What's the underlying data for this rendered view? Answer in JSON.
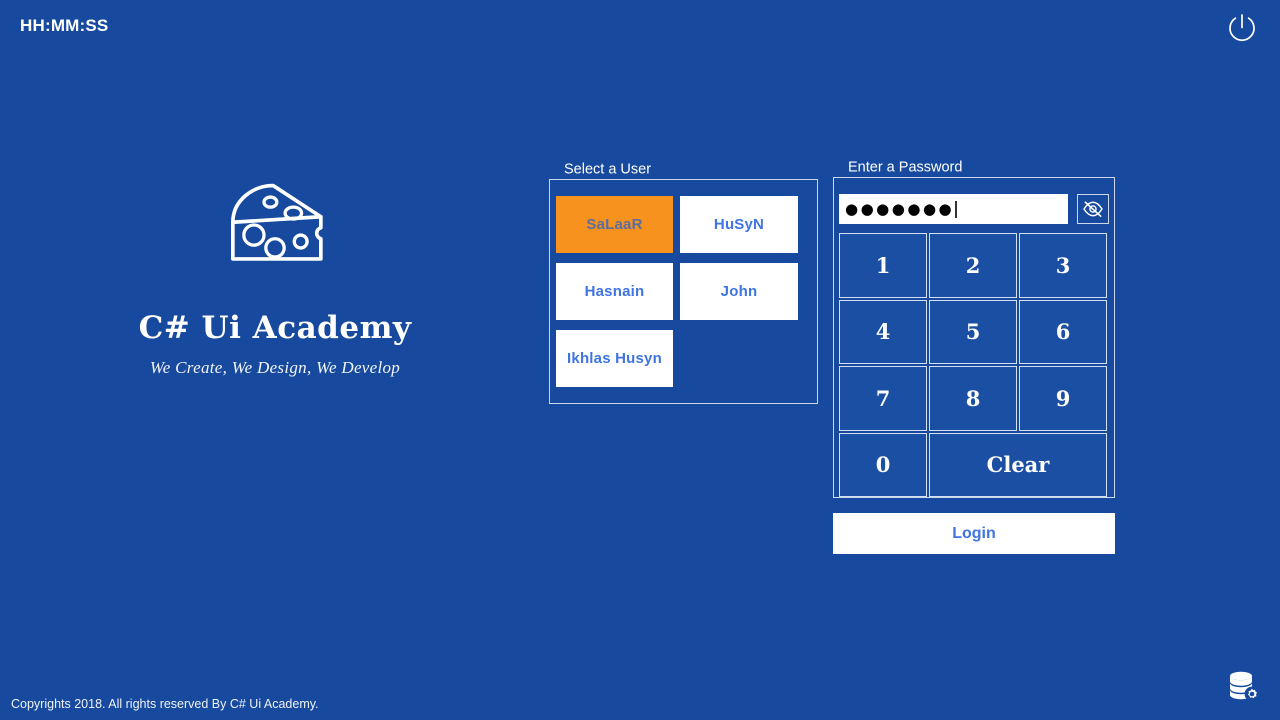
{
  "theme": {
    "background": "#174A9E",
    "accent_orange": "#F7921E",
    "button_white": "#FFFFFF",
    "link_blue": "#3F74E3",
    "selected_text": "#5C6DA0",
    "border_light": "#CDD8EA"
  },
  "topbar": {
    "clock": "HH:MM:SS",
    "power_icon": "power-icon",
    "power_label": "Power"
  },
  "brand": {
    "logo_icon": "cheese-wedge-icon",
    "title": "C# Ui Academy",
    "tagline": "We Create, We Design, We Develop"
  },
  "users_panel": {
    "legend": "Select a User",
    "items": [
      {
        "label": "SaLaaR",
        "selected": true
      },
      {
        "label": "HuSyN",
        "selected": false
      },
      {
        "label": "Hasnain",
        "selected": false
      },
      {
        "label": "John",
        "selected": false
      },
      {
        "label": "Ikhlas Husyn",
        "selected": false
      }
    ]
  },
  "password_panel": {
    "legend": "Enter a Password",
    "field": {
      "value_masked": "●●●●●●●",
      "character_count": 7,
      "placeholder": "",
      "masked": true
    },
    "toggle_icon": "eye-slash-icon",
    "toggle_label": "Show password",
    "keypad": [
      {
        "label": "1",
        "wide": false
      },
      {
        "label": "2",
        "wide": false
      },
      {
        "label": "3",
        "wide": false
      },
      {
        "label": "4",
        "wide": false
      },
      {
        "label": "5",
        "wide": false
      },
      {
        "label": "6",
        "wide": false
      },
      {
        "label": "7",
        "wide": false
      },
      {
        "label": "8",
        "wide": false
      },
      {
        "label": "9",
        "wide": false
      },
      {
        "label": "0",
        "wide": false
      },
      {
        "label": "Clear",
        "wide": true
      }
    ]
  },
  "login": {
    "label": "Login"
  },
  "footer": {
    "copyright": "Copyrights 2018. All rights reserved By C# Ui Academy.",
    "db_settings_icon": "database-gear-icon",
    "db_settings_label": "Database settings"
  }
}
